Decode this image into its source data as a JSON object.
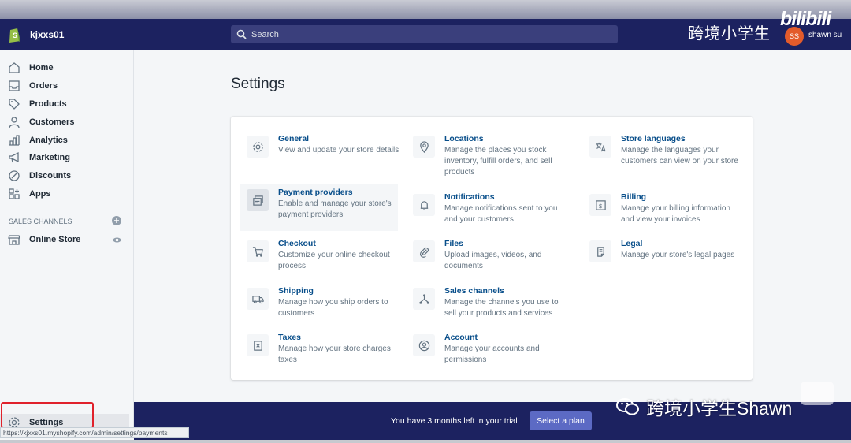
{
  "header": {
    "store_name": "kjxxs01",
    "search_placeholder": "Search",
    "watermark": "跨境小学生",
    "bilibili": "bilibili",
    "avatar_initials": "SS",
    "user_name": "shawn su"
  },
  "sidebar": {
    "items": [
      {
        "label": "Home",
        "icon": "home-icon"
      },
      {
        "label": "Orders",
        "icon": "orders-icon"
      },
      {
        "label": "Products",
        "icon": "tag-icon"
      },
      {
        "label": "Customers",
        "icon": "person-icon"
      },
      {
        "label": "Analytics",
        "icon": "bar-chart-icon"
      },
      {
        "label": "Marketing",
        "icon": "megaphone-icon"
      },
      {
        "label": "Discounts",
        "icon": "discount-icon"
      },
      {
        "label": "Apps",
        "icon": "apps-icon"
      }
    ],
    "sales_channels_title": "SALES CHANNELS",
    "online_store": "Online Store",
    "settings": "Settings",
    "status_url": "https://kjxxs01.myshopify.com/admin/settings/payments"
  },
  "main": {
    "title": "Settings",
    "tiles": [
      {
        "title": "General",
        "desc": "View and update your store details",
        "icon": "gear-icon"
      },
      {
        "title": "Locations",
        "desc": "Manage the places you stock inventory, fulfill orders, and sell products",
        "icon": "location-pin-icon"
      },
      {
        "title": "Store languages",
        "desc": "Manage the languages your customers can view on your store",
        "icon": "translate-icon"
      },
      {
        "title": "Payment providers",
        "desc": "Enable and manage your store's payment providers",
        "icon": "payment-icon"
      },
      {
        "title": "Notifications",
        "desc": "Manage notifications sent to you and your customers",
        "icon": "bell-icon"
      },
      {
        "title": "Billing",
        "desc": "Manage your billing information and view your invoices",
        "icon": "billing-icon"
      },
      {
        "title": "Checkout",
        "desc": "Customize your online checkout process",
        "icon": "cart-icon"
      },
      {
        "title": "Files",
        "desc": "Upload images, videos, and documents",
        "icon": "paperclip-icon"
      },
      {
        "title": "Legal",
        "desc": "Manage your store's legal pages",
        "icon": "legal-icon"
      },
      {
        "title": "Shipping",
        "desc": "Manage how you ship orders to customers",
        "icon": "truck-icon"
      },
      {
        "title": "Sales channels",
        "desc": "Manage the channels you use to sell your products and services",
        "icon": "channels-icon"
      },
      {
        "title": "Taxes",
        "desc": "Manage how your store charges taxes",
        "icon": "taxes-icon"
      },
      {
        "title": "Account",
        "desc": "Manage your accounts and permissions",
        "icon": "account-icon"
      }
    ]
  },
  "trial": {
    "text": "You have 3 months left in your trial",
    "button": "Select a plan"
  },
  "watermark_bottom": "跨境小学生Shawn",
  "colors": {
    "topbar": "#1c2260",
    "link": "#084e8a",
    "plan_button": "#5c6ac4",
    "highlight_box": "#e0212b"
  }
}
